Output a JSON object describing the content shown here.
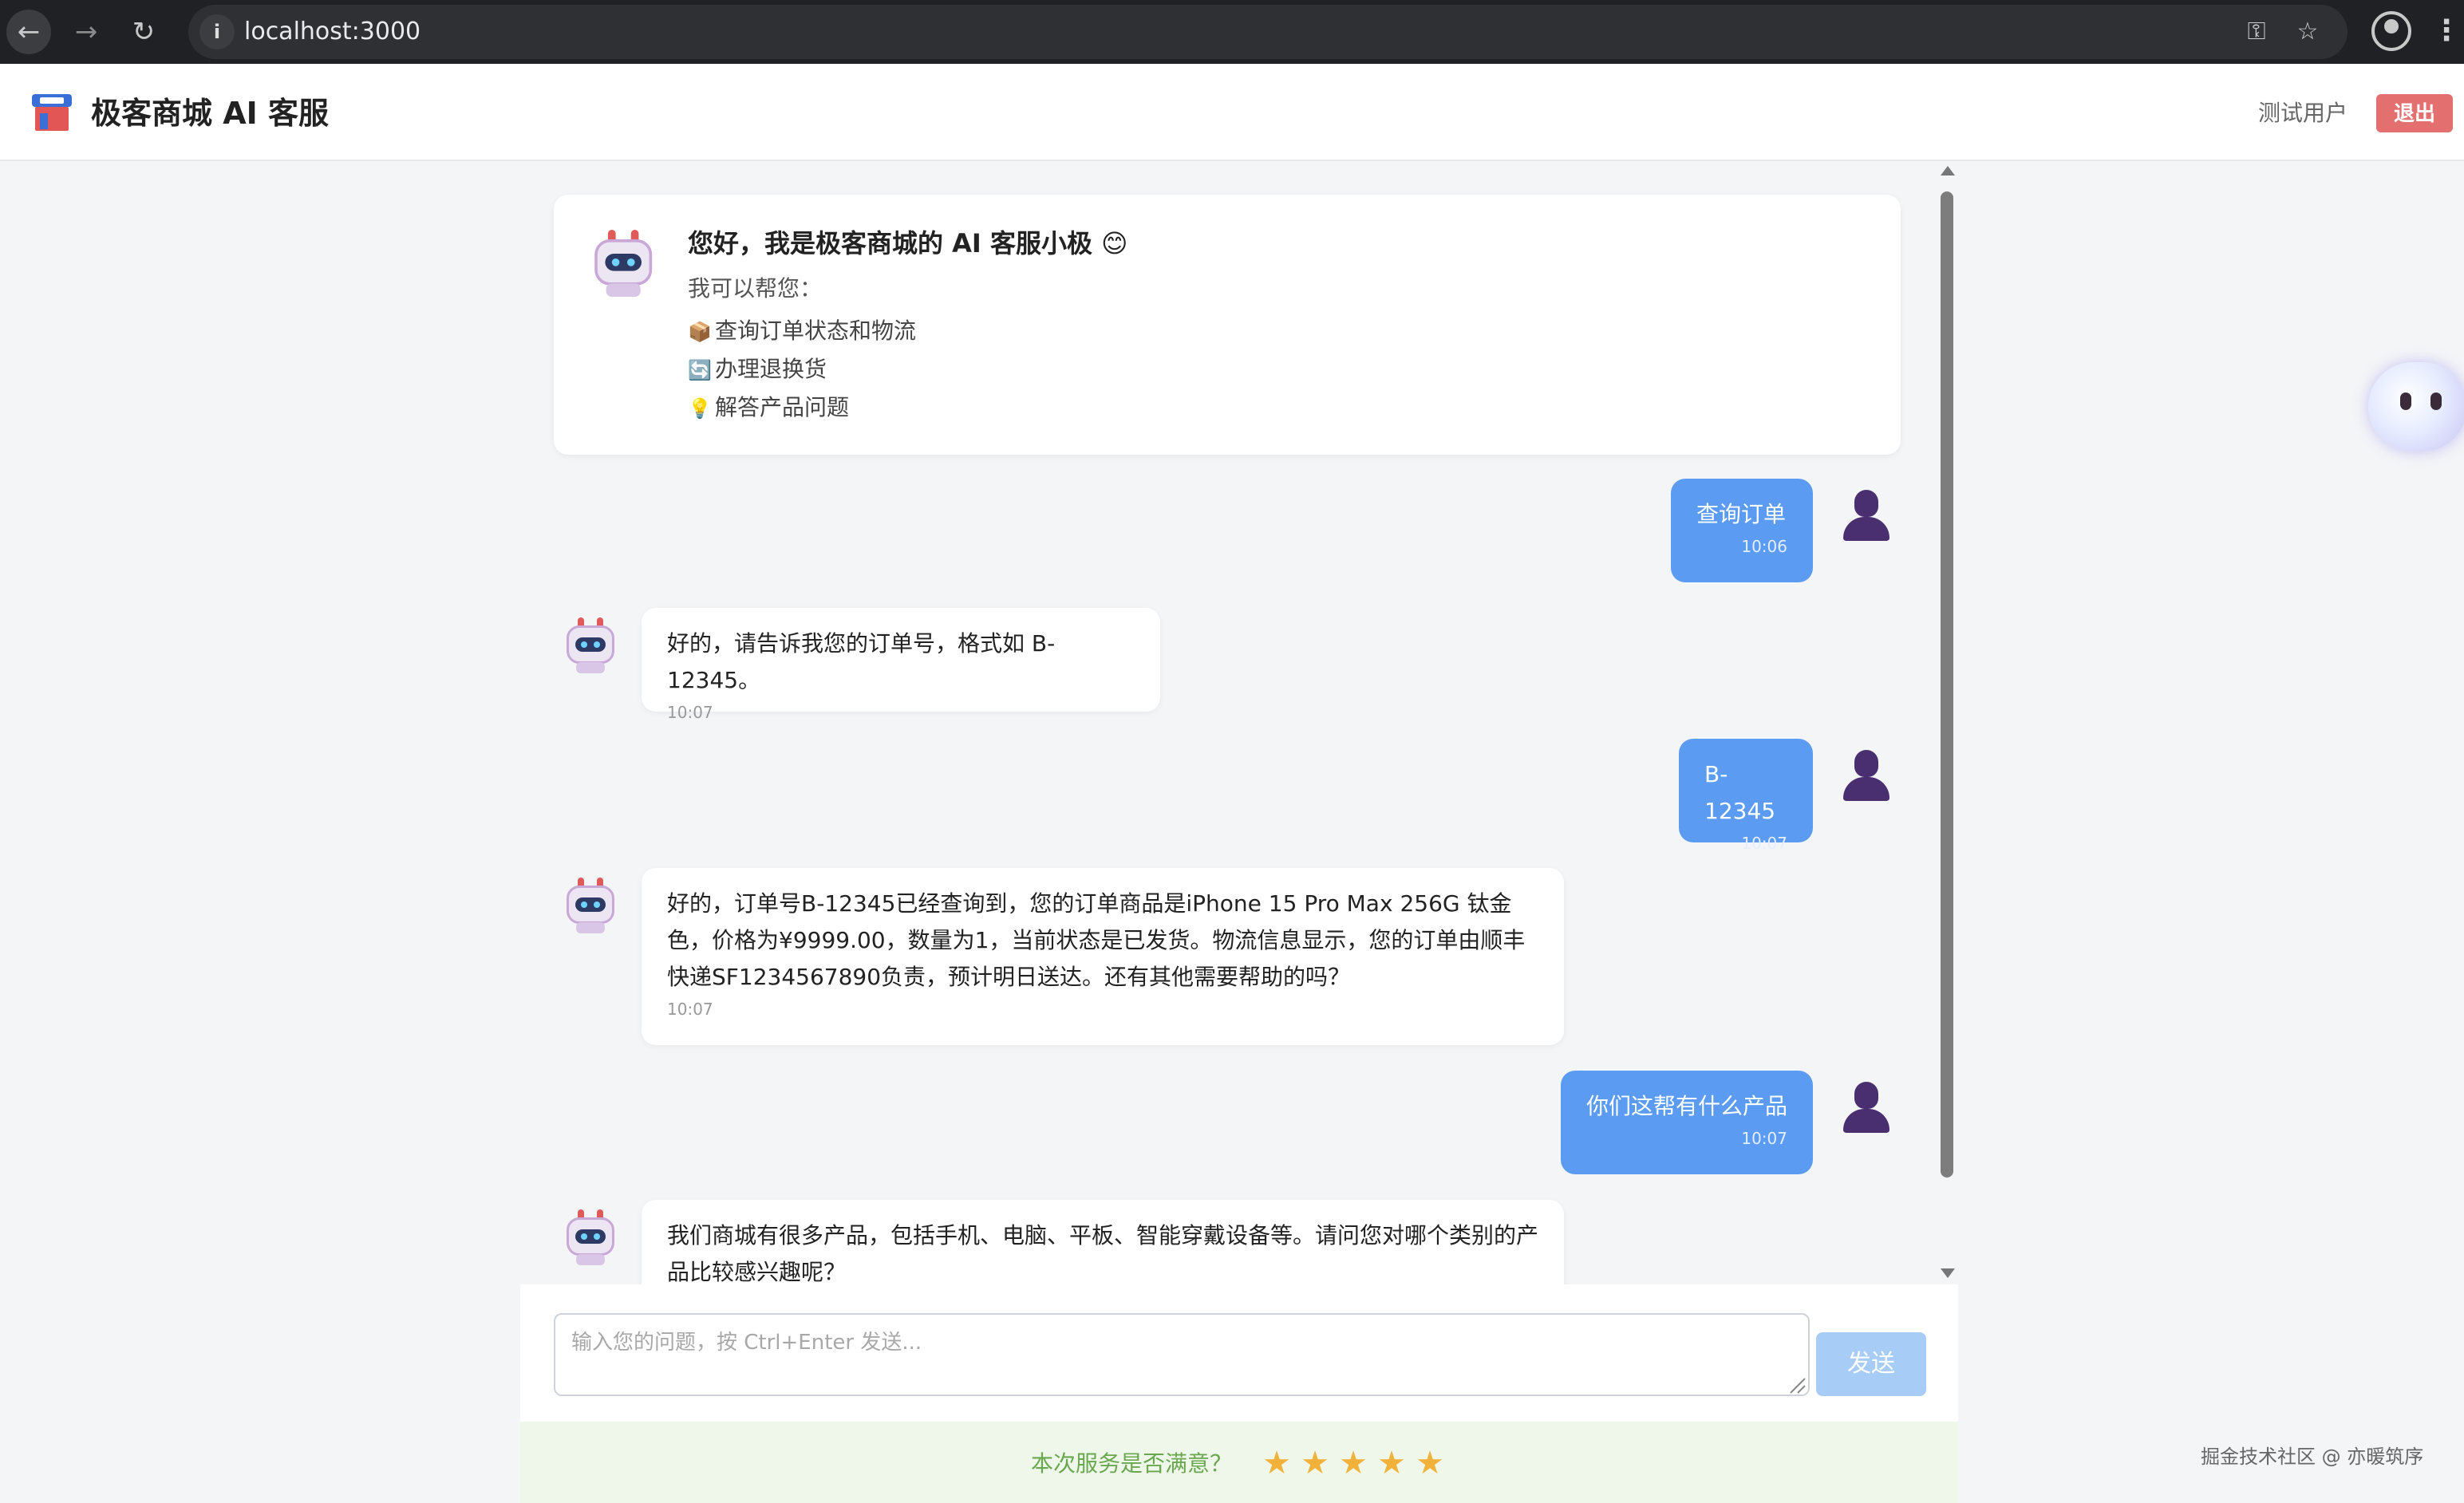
{
  "browser": {
    "url": "localhost:3000",
    "icons": {
      "back": "arrow-left-icon",
      "forward": "arrow-right-icon",
      "reload": "reload-icon",
      "site_info": "info-icon",
      "password": "key-icon",
      "bookmark": "star-outline-icon",
      "profile": "profile-icon",
      "menu": "kebab-menu-icon"
    }
  },
  "header": {
    "logo": "store-icon",
    "title": "极客商城 AI 客服",
    "user_name": "测试用户",
    "logout_label": "退出"
  },
  "welcome": {
    "avatar": "robot-icon",
    "title": "您好，我是极客商城的 AI 客服小极 😊",
    "subtitle": "我可以帮您：",
    "capabilities": [
      {
        "icon": "📦",
        "text": "查询订单状态和物流"
      },
      {
        "icon": "🔄",
        "text": "办理退换货"
      },
      {
        "icon": "💡",
        "text": "解答产品问题"
      }
    ]
  },
  "messages": [
    {
      "role": "user",
      "text": "查询订单",
      "time": "10:06"
    },
    {
      "role": "bot",
      "text": "好的，请告诉我您的订单号，格式如 B-12345。",
      "time": "10:07"
    },
    {
      "role": "user",
      "text": "B-12345",
      "time": "10:07"
    },
    {
      "role": "bot",
      "text": "好的，订单号B-12345已经查询到，您的订单商品是iPhone 15 Pro Max 256G 钛金色，价格为¥9999.00，数量为1，当前状态是已发货。物流信息显示，您的订单由顺丰快递SF1234567890负责，预计明日送达。还有其他需要帮助的吗？",
      "time": "10:07"
    },
    {
      "role": "user",
      "text": "你们这帮有什么产品",
      "time": "10:07"
    },
    {
      "role": "bot",
      "text": "我们商城有很多产品，包括手机、电脑、平板、智能穿戴设备等。请问您对哪个类别的产品比较感兴趣呢？",
      "time": ""
    }
  ],
  "input": {
    "value": "",
    "placeholder": "输入您的问题，按 Ctrl+Enter 发送...",
    "send_label": "发送"
  },
  "rating": {
    "label": "本次服务是否满意？",
    "max": 5,
    "star_glyph": "★"
  },
  "floating_assistant": "assistant-orb-icon",
  "watermark": "掘金技术社区 @ 亦暖筑序",
  "colors": {
    "user_bubble": "#5b9cf2",
    "logout": "#e36f6f",
    "send_disabled": "#a7cdf6",
    "rating_text": "#6aa84f",
    "star": "#f2b13b",
    "rating_bg": "#eef7e9"
  }
}
